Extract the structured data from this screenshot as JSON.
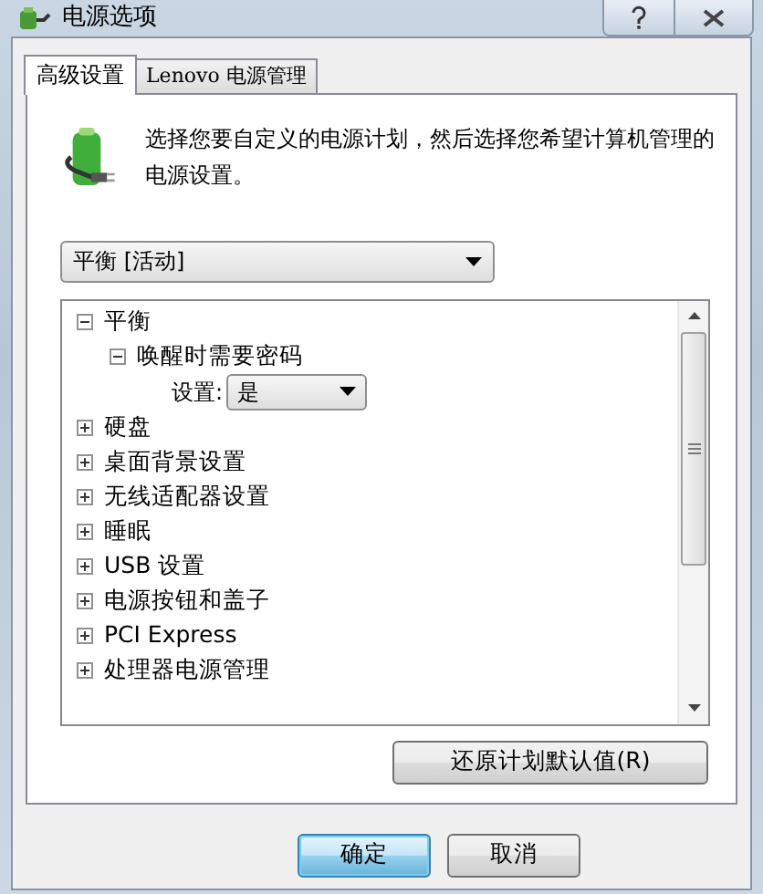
{
  "window": {
    "title": "电源选项"
  },
  "tabs": [
    {
      "label": "高级设置",
      "selected": true
    },
    {
      "label": "Lenovo 电源管理",
      "selected": false
    }
  ],
  "description": "选择您要自定义的电源计划，然后选择您希望计算机管理的电源设置。",
  "plan_select": {
    "value": "平衡 [活动]"
  },
  "tree": [
    {
      "label": "平衡",
      "expanded": true,
      "children": [
        {
          "label": "唤醒时需要密码",
          "expanded": true,
          "setting": {
            "label": "设置:",
            "value": "是"
          }
        }
      ]
    },
    {
      "label": "硬盘",
      "expanded": false
    },
    {
      "label": "桌面背景设置",
      "expanded": false
    },
    {
      "label": "无线适配器设置",
      "expanded": false
    },
    {
      "label": "睡眠",
      "expanded": false
    },
    {
      "label": "USB 设置",
      "expanded": false
    },
    {
      "label": "电源按钮和盖子",
      "expanded": false
    },
    {
      "label": "PCI Express",
      "expanded": false
    },
    {
      "label": "处理器电源管理",
      "expanded": false
    }
  ],
  "restore_button": "还原计划默认值(R)",
  "buttons": [
    {
      "label": "确定",
      "kind": "default"
    },
    {
      "label": "取消",
      "kind": "normal"
    }
  ]
}
